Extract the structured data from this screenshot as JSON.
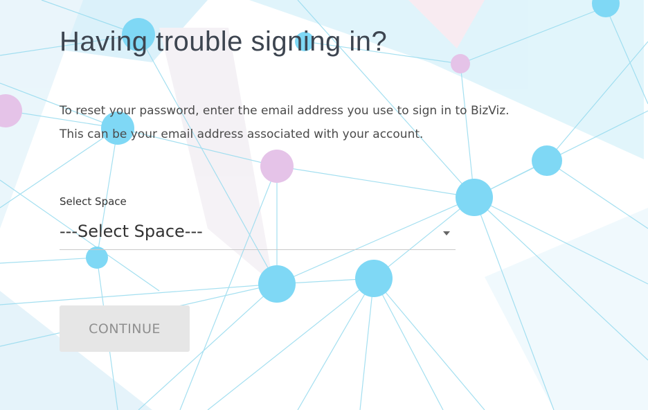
{
  "heading": "Having trouble signing in?",
  "instructions": {
    "line1": "To reset your password, enter the email address you use to sign in to BizViz.",
    "line2": "This can be your email address associated with your account."
  },
  "space_select": {
    "label": "Select Space",
    "selected_value": "---Select Space---"
  },
  "continue_button": {
    "label": "CONTINUE",
    "state": "disabled"
  },
  "colors": {
    "node_blue": "#7fd8f5",
    "node_pink": "#e5c3e8",
    "line_blue": "#9adcef",
    "button_bg": "#e6e6e6",
    "button_text": "#8f8f8f"
  }
}
